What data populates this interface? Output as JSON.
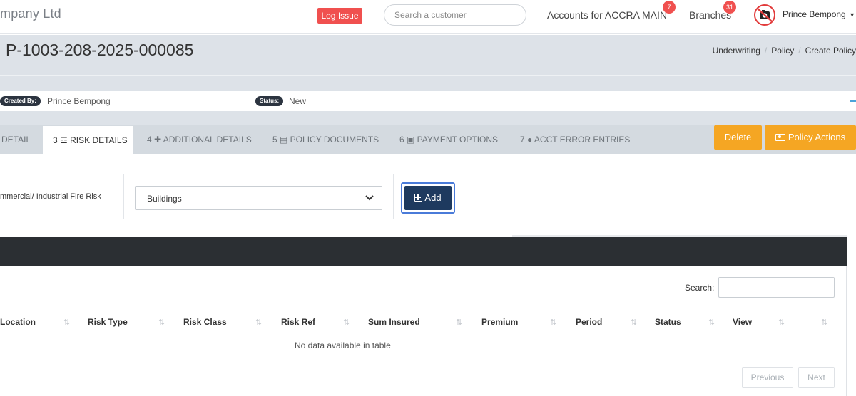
{
  "topbar": {
    "brand": "mpany Ltd",
    "log_issue_label": "Log Issue",
    "search_placeholder": "Search a customer",
    "accounts_label": "Accounts for ACCRA MAIN",
    "accounts_badge": "7",
    "branches_label": "Branches",
    "branches_badge": "31",
    "user_name": "Prince Bempong",
    "user_caret": "▾"
  },
  "header": {
    "policy_number": "P-1003-208-2025-000085",
    "breadcrumb": [
      "Underwriting",
      "Policy",
      "Create Policy"
    ]
  },
  "info": {
    "created_by_label": "Created By:",
    "created_by_value": "Prince Bempong",
    "status_label": "Status:",
    "status_value": "New"
  },
  "tabs": [
    {
      "label": "DETAIL"
    },
    {
      "label": "3 ☲ RISK DETAILS"
    },
    {
      "label": "4 ✚ ADDITIONAL DETAILS"
    },
    {
      "label": "5 ▤ POLICY DOCUMENTS"
    },
    {
      "label": "6 ▣ PAYMENT OPTIONS"
    },
    {
      "label": "7 ● ACCT ERROR ENTRIES"
    }
  ],
  "actions": {
    "delete_label": "Delete",
    "policy_actions_label": "Policy Actions"
  },
  "form": {
    "risk_label": "mmercial/ Industrial Fire Risk",
    "risk_type_selected": "Buildings",
    "add_label": "Add"
  },
  "table": {
    "search_label": "Search:",
    "columns": [
      "Location",
      "Risk Type",
      "Risk Class",
      "Risk Ref",
      "Sum Insured",
      "Premium",
      "Period",
      "Status",
      "View"
    ],
    "empty_message": "No data available in table",
    "previous_label": "Previous",
    "next_label": "Next"
  },
  "colors": {
    "danger": "#f0504f",
    "warning": "#f5a623",
    "primary_dark": "#1e3a5f",
    "panel_header": "#2b2f33"
  }
}
